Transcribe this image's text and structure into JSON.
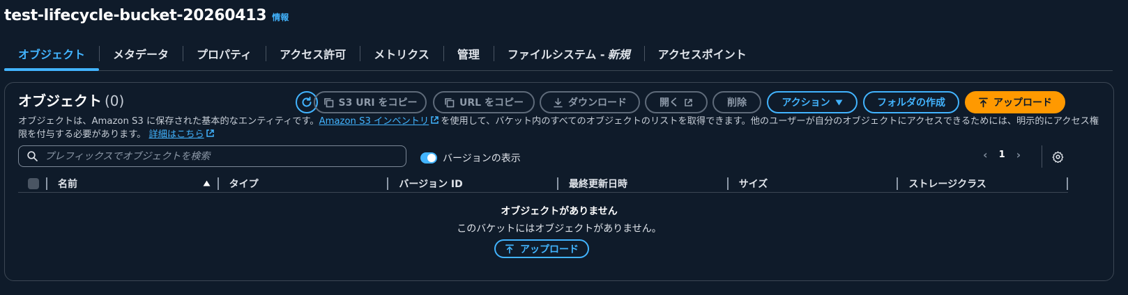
{
  "bucket": {
    "title": "test-lifecycle-bucket-20260413",
    "info_label": "情報"
  },
  "tabs": [
    {
      "label": "オブジェクト"
    },
    {
      "label": "メタデータ"
    },
    {
      "label": "プロパティ"
    },
    {
      "label": "アクセス許可"
    },
    {
      "label": "メトリクス"
    },
    {
      "label": "管理"
    },
    {
      "label": "ファイルシステム -",
      "suffix": "新規"
    },
    {
      "label": "アクセスポイント"
    }
  ],
  "objects": {
    "title": "オブジェクト",
    "count": "(0)",
    "toolbar": {
      "copy_s3_uri": "S3 URI をコピー",
      "copy_url": "URL をコピー",
      "download": "ダウンロード",
      "open": "開く",
      "delete": "削除",
      "actions": "アクション",
      "create_folder": "フォルダの作成",
      "upload": "アップロード"
    },
    "description": {
      "part1": "オブジェクトは、Amazon S3 に保存された基本的なエンティティです。",
      "inventory_link": "Amazon S3 インベントリ",
      "part2": "を使用して、バケット内のすべてのオブジェクトのリストを取得できます。他のユーザーが自分のオブジェクトにアクセスできるためには、明示的にアクセス権限を付与する必要があります。",
      "details_link": "詳細はこちら"
    },
    "search": {
      "placeholder": "プレフィックスでオブジェクトを検索",
      "value": ""
    },
    "show_versions": {
      "label": "バージョンの表示",
      "enabled": true
    },
    "pagination": {
      "page": "1"
    },
    "columns": [
      "名前",
      "タイプ",
      "バージョン ID",
      "最終更新日時",
      "サイズ",
      "ストレージクラス"
    ],
    "empty": {
      "title": "オブジェクトがありません",
      "description": "このバケットにはオブジェクトがありません。",
      "upload": "アップロード"
    }
  },
  "colors": {
    "accent": "#42b4ff",
    "primary_button": "#ff9900",
    "background": "#0f1b2a"
  }
}
